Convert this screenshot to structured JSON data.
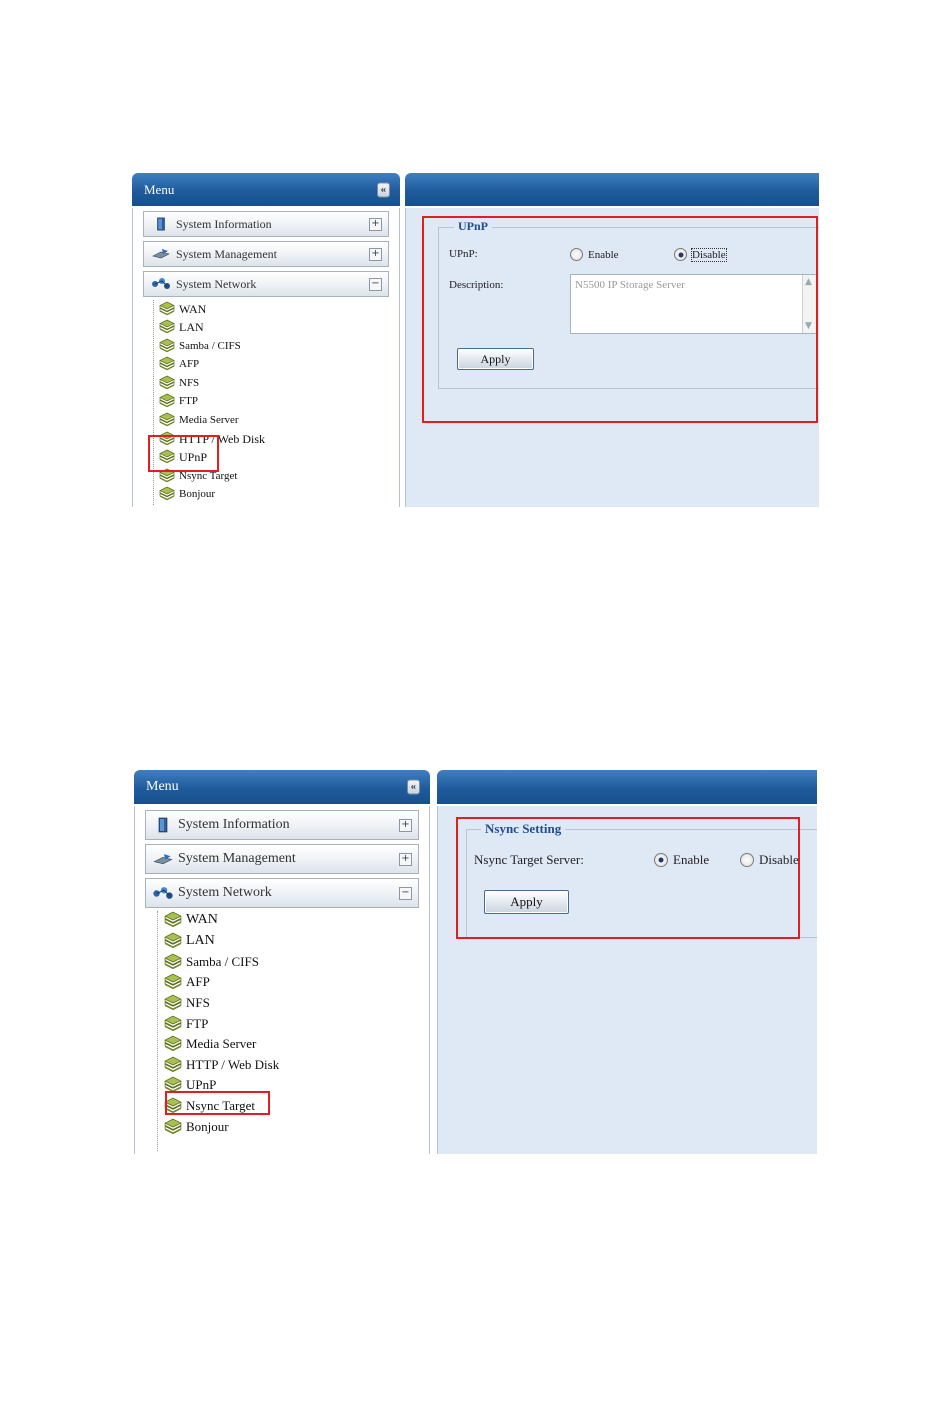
{
  "screenshot1": {
    "menu_title": "Menu",
    "collapse_label": "«",
    "accordion": [
      {
        "label": "System Information",
        "toggle": "+"
      },
      {
        "label": "System Management",
        "toggle": "+"
      },
      {
        "label": "System Network",
        "toggle": "−"
      }
    ],
    "tree_items": [
      "WAN",
      "LAN",
      "Samba / CIFS",
      "AFP",
      "NFS",
      "FTP",
      "Media Server",
      "HTTP / Web Disk",
      "UPnP",
      "Nsync Target",
      "Bonjour"
    ],
    "panel": {
      "legend": "UPnP",
      "field_label": "UPnP:",
      "enable_label": "Enable",
      "disable_label": "Disable",
      "selected": "Disable",
      "description_label": "Description:",
      "description_value": "N5500 IP Storage Server",
      "apply_label": "Apply"
    }
  },
  "screenshot2": {
    "menu_title": "Menu",
    "collapse_label": "«",
    "accordion": [
      {
        "label": "System Information",
        "toggle": "+"
      },
      {
        "label": "System Management",
        "toggle": "+"
      },
      {
        "label": "System Network",
        "toggle": "−"
      }
    ],
    "tree_items": [
      "WAN",
      "LAN",
      "Samba / CIFS",
      "AFP",
      "NFS",
      "FTP",
      "Media Server",
      "HTTP / Web Disk",
      "UPnP",
      "Nsync Target",
      "Bonjour"
    ],
    "panel": {
      "legend": "Nsync Setting",
      "field_label": "Nsync Target Server:",
      "enable_label": "Enable",
      "disable_label": "Disable",
      "selected": "Enable",
      "apply_label": "Apply"
    }
  },
  "colors": {
    "header_blue": "#1f5b9c",
    "content_bg": "#dfe8f5",
    "highlight_red": "#e02020",
    "legend_blue": "#1f4e8c",
    "tree_icon_green": "#8aa33a"
  }
}
